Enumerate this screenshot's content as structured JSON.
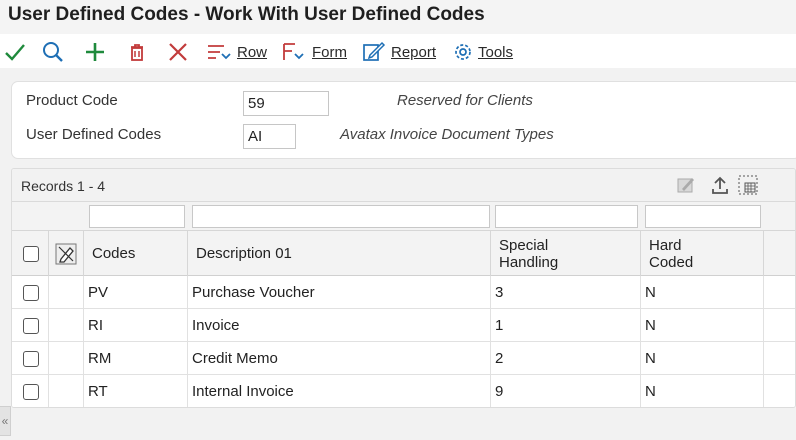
{
  "title": "User Defined Codes - Work With User Defined Codes",
  "toolbar": {
    "select": "select-icon",
    "find": "search-icon",
    "add": "add-icon",
    "delete": "delete-icon",
    "close": "close-icon",
    "row_label": "Row",
    "form_label": "Form",
    "report_label": "Report",
    "tools_label": "Tools",
    "accent_color": "#1f8a3c",
    "action_color": "#1e6fb5",
    "delete_color": "#c23b3b"
  },
  "header": {
    "product_code_label": "Product Code",
    "product_code_value": "59",
    "product_code_desc": "Reserved for Clients",
    "udc_label": "User Defined Codes",
    "udc_value": "AI",
    "udc_desc": "Avatax Invoice Document Types"
  },
  "grid": {
    "records_label": "Records 1 - 4",
    "columns": {
      "codes": "Codes",
      "description": "Description 01",
      "special_1": "Special",
      "special_2": "Handling",
      "hard_1": "Hard",
      "hard_2": "Coded"
    },
    "rows": [
      {
        "code": "PV",
        "description": "Purchase Voucher",
        "special": "3",
        "hard": "N"
      },
      {
        "code": "RI",
        "description": "Invoice",
        "special": "1",
        "hard": "N"
      },
      {
        "code": "RM",
        "description": "Credit Memo",
        "special": "2",
        "hard": "N"
      },
      {
        "code": "RT",
        "description": "Internal Invoice",
        "special": "9",
        "hard": "N"
      }
    ]
  },
  "collapse_glyph": "«"
}
